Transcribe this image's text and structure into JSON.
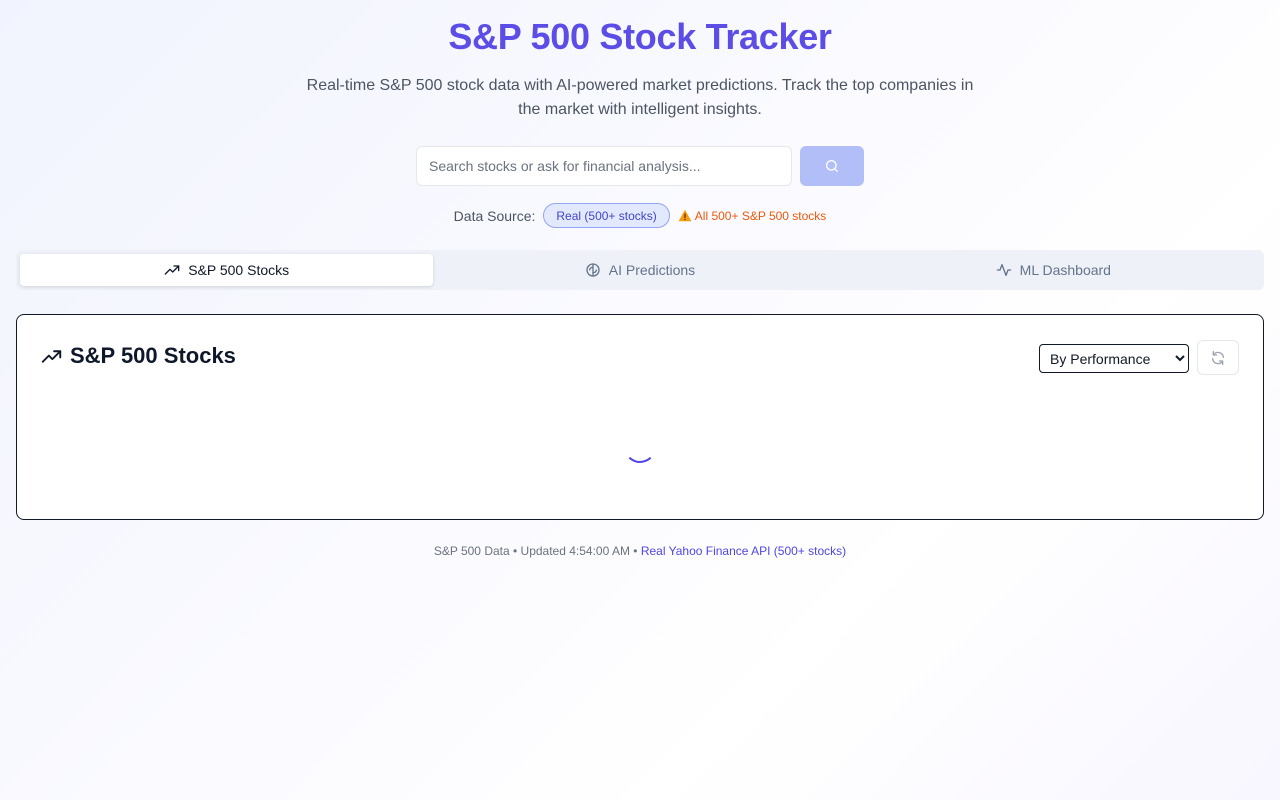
{
  "header": {
    "title": "S&P 500 Stock Tracker",
    "subtitle": "Real-time S&P 500 stock data with AI-powered market predictions. Track the top companies in the market with intelligent insights."
  },
  "search": {
    "placeholder": "Search stocks or ask for financial analysis..."
  },
  "data_source": {
    "label": "Data Source:",
    "badge": "Real (500+ stocks)",
    "note": "All 500+ S&P 500 stocks"
  },
  "tabs": [
    {
      "label": "S&P 500 Stocks",
      "icon": "trending-up-icon"
    },
    {
      "label": "AI Predictions",
      "icon": "brain-icon"
    },
    {
      "label": "ML Dashboard",
      "icon": "activity-icon"
    }
  ],
  "panel": {
    "title": "S&P 500 Stocks",
    "sort_selected": "By Performance"
  },
  "footer": {
    "text": "S&P 500 Data • Updated 4:54:00 AM • ",
    "link": "Real Yahoo Finance API (500+ stocks)"
  },
  "colors": {
    "brand": "#5b4de6",
    "accent": "#4f46e5",
    "warning": "#ea580c"
  }
}
